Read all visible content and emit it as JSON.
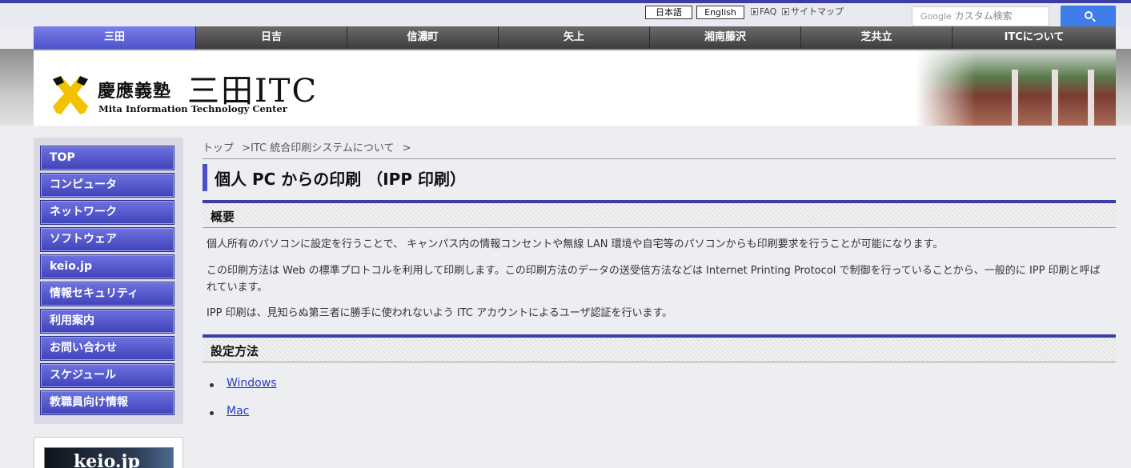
{
  "util": {
    "lang_ja": "日本語",
    "lang_en": "English",
    "faq": "FAQ",
    "sitemap": "サイトマップ",
    "search_brand": "Google",
    "search_placeholder": "カスタム検索"
  },
  "nav": [
    {
      "label": "三田",
      "active": true
    },
    {
      "label": "日吉"
    },
    {
      "label": "信濃町"
    },
    {
      "label": "矢上"
    },
    {
      "label": "湘南藤沢"
    },
    {
      "label": "芝共立"
    },
    {
      "label": "ITCについて"
    }
  ],
  "logo": {
    "jp": "慶應義塾",
    "itc": "三田ITC",
    "en": "Mita Information Technology Center"
  },
  "sidebar": {
    "items": [
      {
        "label": "TOP"
      },
      {
        "label": "コンピュータ"
      },
      {
        "label": "ネットワーク"
      },
      {
        "label": "ソフトウェア"
      },
      {
        "label": "keio.jp"
      },
      {
        "label": "情報セキュリティ"
      },
      {
        "label": "利用案内"
      },
      {
        "label": "お問い合わせ"
      },
      {
        "label": "スケジュール"
      },
      {
        "label": "教職員向け情報"
      }
    ],
    "banner": "keio.jp"
  },
  "breadcrumb": [
    "トップ",
    ">ITC 統合印刷システムについて",
    ">"
  ],
  "page_title": "個人 PC からの印刷 （IPP 印刷）",
  "sections": {
    "overview": {
      "heading": "概要",
      "paragraphs": [
        "個人所有のパソコンに設定を行うことで、 キャンパス内の情報コンセントや無線 LAN 環境や自宅等のパソコンからも印刷要求を行うことが可能になります。",
        "この印刷方法は Web の標準プロトコルを利用して印刷します。この印刷方法のデータの送受信方法などは Internet Printing Protocol で制御を行っていることから、一般的に IPP 印刷と呼ばれています。",
        "IPP 印刷は、見知らぬ第三者に勝手に使われないよう ITC アカウントによるユーザ認証を行います。"
      ]
    },
    "setup": {
      "heading": "設定方法",
      "links": [
        "Windows",
        "Mac"
      ]
    }
  },
  "colors": {
    "accent": "#3b3fa3",
    "nav_active": "#5a5fd6",
    "link": "#2a3bc0"
  }
}
